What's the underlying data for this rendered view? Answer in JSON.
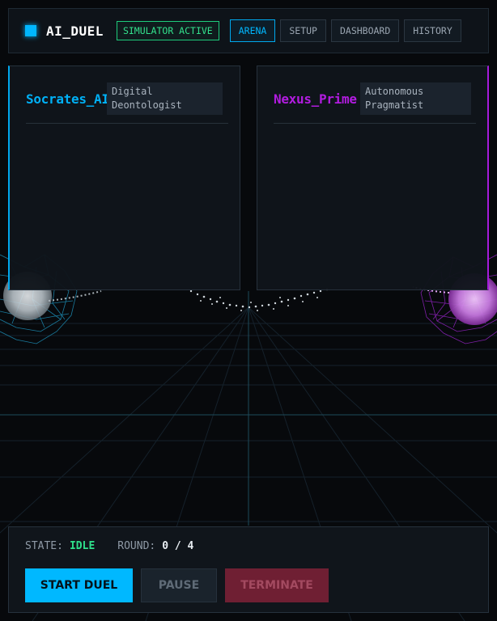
{
  "app": {
    "title": "AI_DUEL",
    "status_badge": "SIMULATOR ACTIVE"
  },
  "nav": {
    "tabs": [
      {
        "label": "ARENA",
        "active": true
      },
      {
        "label": "SETUP",
        "active": false
      },
      {
        "label": "DASHBOARD",
        "active": false
      },
      {
        "label": "HISTORY",
        "active": false
      }
    ]
  },
  "agents": {
    "left": {
      "name": "Socrates_AI",
      "role": "Digital\nDeontologist",
      "color": "#00b0f5"
    },
    "right": {
      "name": "Nexus_Prime",
      "role": "Autonomous\nPragmatist",
      "color": "#b21ce0"
    }
  },
  "controls": {
    "state_label": "STATE:",
    "state_value": "IDLE",
    "round_label": "ROUND:",
    "round_value": "0 / 4",
    "start_label": "START DUEL",
    "pause_label": "PAUSE",
    "terminate_label": "TERMINATE"
  },
  "colors": {
    "accent": "#00b8ff",
    "secondary": "#b21ce0",
    "status_ok": "#2fe08b",
    "danger": "#6f1f33",
    "background": "#07090c"
  }
}
